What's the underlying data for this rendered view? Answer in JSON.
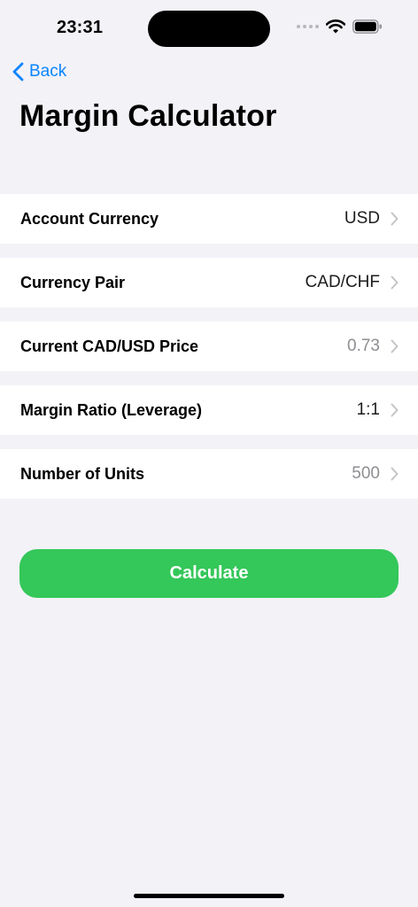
{
  "status_bar": {
    "time": "23:31",
    "icons": [
      "cellular-signal-icon",
      "wifi-icon",
      "battery-icon"
    ]
  },
  "nav": {
    "back_label": "Back",
    "title": "Margin Calculator"
  },
  "rows": [
    {
      "label": "Account Currency",
      "value": "USD",
      "value_style": "filled"
    },
    {
      "label": "Currency Pair",
      "value": "CAD/CHF",
      "value_style": "filled"
    },
    {
      "label": "Current CAD/USD Price",
      "value": "0.73",
      "value_style": "placeholder"
    },
    {
      "label": "Margin Ratio (Leverage)",
      "value": "1:1",
      "value_style": "filled"
    },
    {
      "label": "Number of Units",
      "value": "500",
      "value_style": "placeholder"
    }
  ],
  "actions": {
    "calculate_label": "Calculate"
  },
  "colors": {
    "background": "#f2f2f7",
    "accent": "#0a84ff",
    "button": "#34c759",
    "placeholder": "#8e8e93",
    "chevron": "#c4c4c7"
  }
}
